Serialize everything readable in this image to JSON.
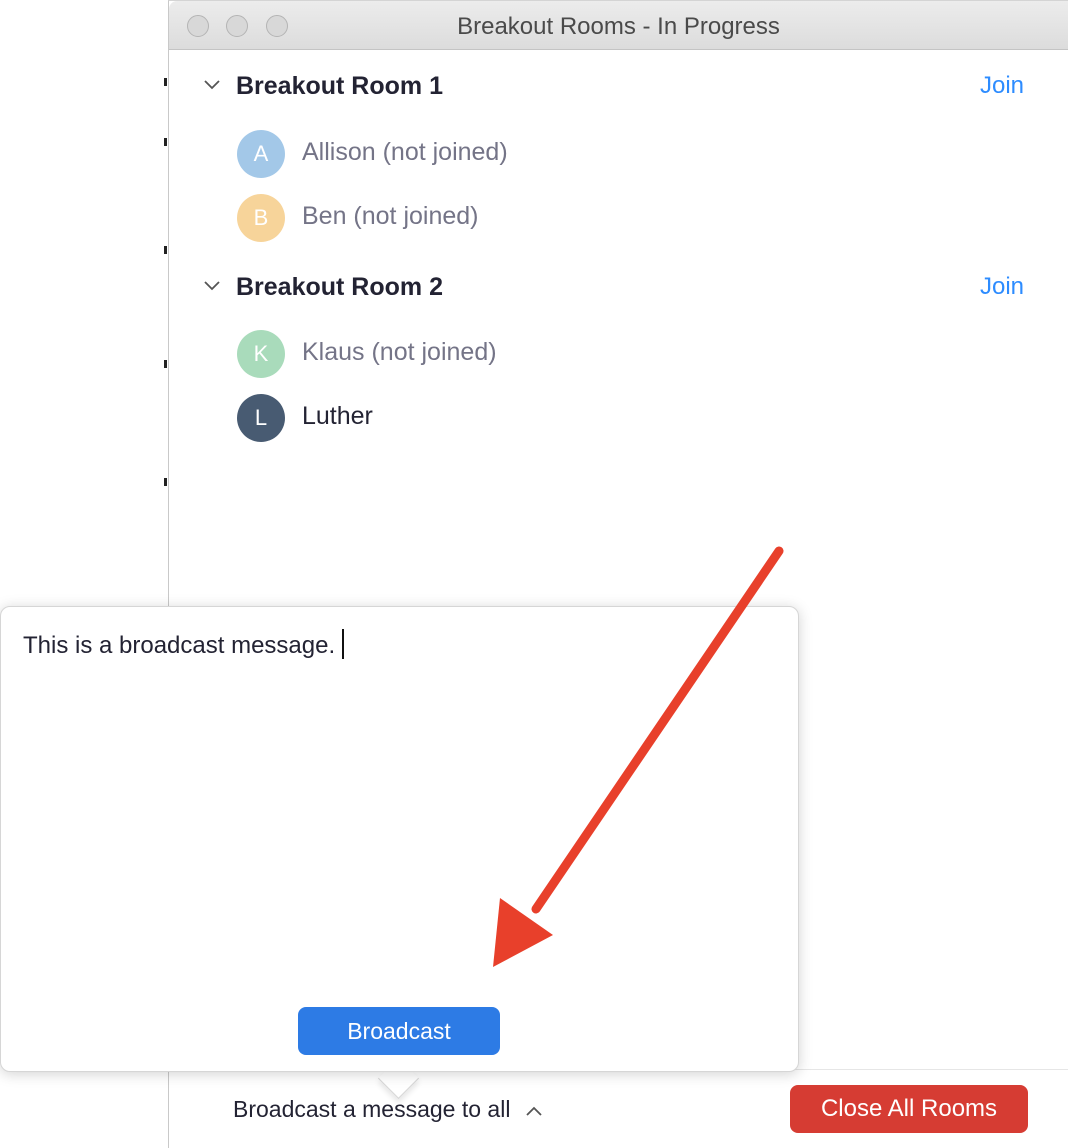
{
  "window": {
    "title": "Breakout Rooms - In Progress"
  },
  "rooms": [
    {
      "title": "Breakout Room 1",
      "join_label": "Join",
      "participants": [
        {
          "initial": "A",
          "name": "Allison (not joined)",
          "color": "#a3c8e8"
        },
        {
          "initial": "B",
          "name": "Ben (not joined)",
          "color": "#f7d49a"
        }
      ]
    },
    {
      "title": "Breakout Room 2",
      "join_label": "Join",
      "participants": [
        {
          "initial": "K",
          "name": "Klaus (not joined)",
          "color": "#a9dbbb"
        },
        {
          "initial": "L",
          "name": "Luther",
          "color": "#485b72"
        }
      ]
    }
  ],
  "broadcast_popover": {
    "message": "This is a broadcast message.",
    "button_label": "Broadcast"
  },
  "footer": {
    "broadcast_toggle_label": "Broadcast a message to all",
    "close_all_label": "Close All Rooms"
  },
  "colors": {
    "link": "#2d8cff",
    "primary_button": "#2d7be5",
    "danger_button": "#d63c33",
    "annotation_arrow": "#e8402b"
  },
  "icons": {
    "room_collapse": "chevron-down-icon",
    "toggle_caret": "chevron-up-icon",
    "annotation": "red-arrow"
  }
}
